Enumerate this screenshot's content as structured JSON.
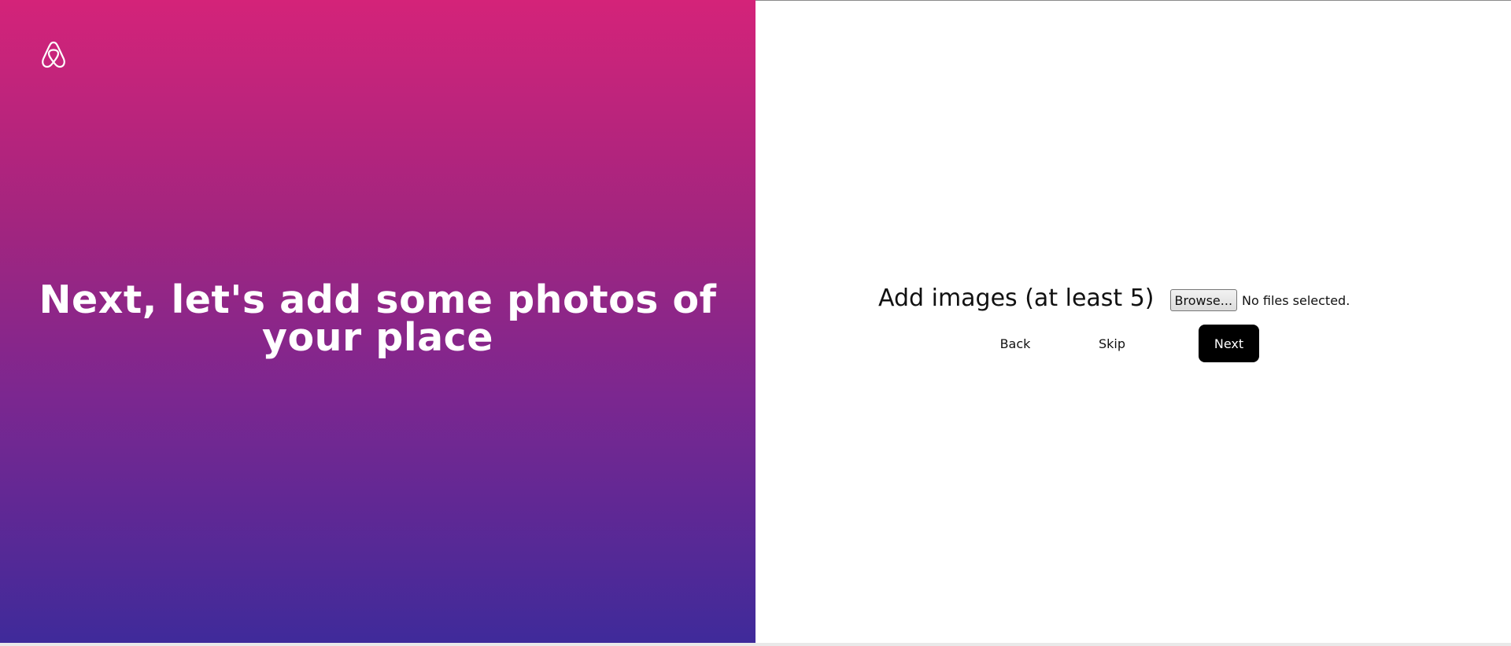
{
  "hero": {
    "title": "Next, let's add some photos of your place",
    "logo_icon": "airbnb-logo-icon"
  },
  "upload": {
    "label": "Add images (at least 5)",
    "browse_label": "Browse...",
    "status": "No files selected."
  },
  "nav": {
    "back_label": "Back",
    "skip_label": "Skip",
    "next_label": "Next"
  },
  "colors": {
    "gradient_top": "#d42379",
    "gradient_bottom": "#3f2a9a",
    "next_button_bg": "#000000",
    "next_button_text": "#ffffff"
  }
}
